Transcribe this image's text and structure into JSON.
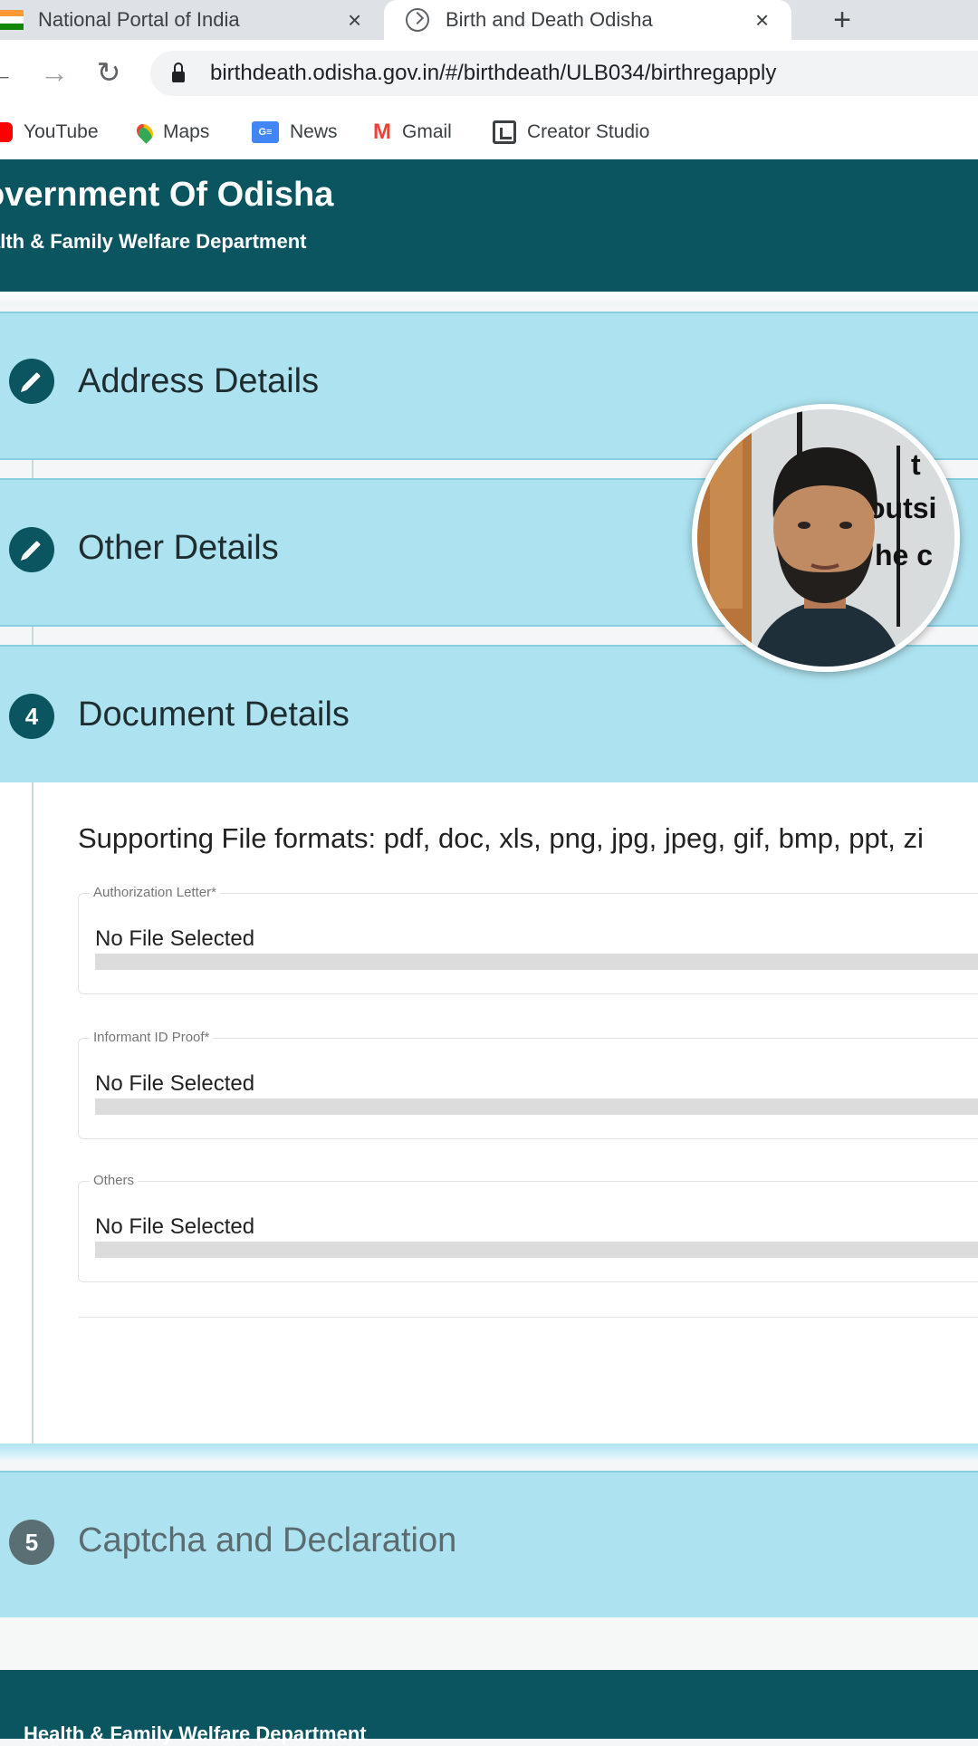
{
  "browser": {
    "tabs": [
      {
        "title": "National Portal of India",
        "icon": "india-flag-icon",
        "active": false
      },
      {
        "title": "Birth and Death Odisha",
        "icon": "site-icon",
        "active": true
      }
    ],
    "new_tab_glyph": "+",
    "close_glyph": "×",
    "url": "birthdeath.odisha.gov.in/#/birthdeath/ULB034/birthregapply",
    "nav": {
      "back": "←",
      "forward": "→",
      "reload": "↻"
    },
    "bookmarks": [
      {
        "label": "YouTube",
        "icon": "youtube-icon"
      },
      {
        "label": "Maps",
        "icon": "maps-icon"
      },
      {
        "label": "News",
        "icon": "news-icon"
      },
      {
        "label": "Gmail",
        "icon": "gmail-icon"
      },
      {
        "label": "Creator Studio",
        "icon": "creator-studio-icon"
      }
    ],
    "news_icon_text": "G≡",
    "gmail_icon_text": "M"
  },
  "header": {
    "title": "overnment Of Odisha",
    "subtitle": "alth & Family Welfare Department"
  },
  "steps": [
    {
      "badge": "edit",
      "title": "Address Details"
    },
    {
      "badge": "edit",
      "title": "Other Details"
    },
    {
      "badge": "4",
      "title": "Document Details"
    },
    {
      "badge": "5",
      "title": "Captcha and Declaration"
    }
  ],
  "documents": {
    "formats_text": "Supporting File formats: pdf, doc, xls, png, jpg, jpeg, gif, bmp, ppt, zi",
    "fields": [
      {
        "label": "Authorization Letter*",
        "value": "No File Selected",
        "progress": 0
      },
      {
        "label": "Informant ID Proof*",
        "value": "No File Selected",
        "progress": 0
      },
      {
        "label": "Others",
        "value": "No File Selected",
        "progress": 0
      }
    ]
  },
  "footer": {
    "text": "Health & Family Welfare Department"
  },
  "overlay": {
    "type": "webcam",
    "sign_text_lines": [
      "t",
      "outsi",
      "he c"
    ]
  },
  "colors": {
    "header_bg": "#0b5560",
    "step_bg": "#ade3f0",
    "step_border": "#86cfe0"
  }
}
